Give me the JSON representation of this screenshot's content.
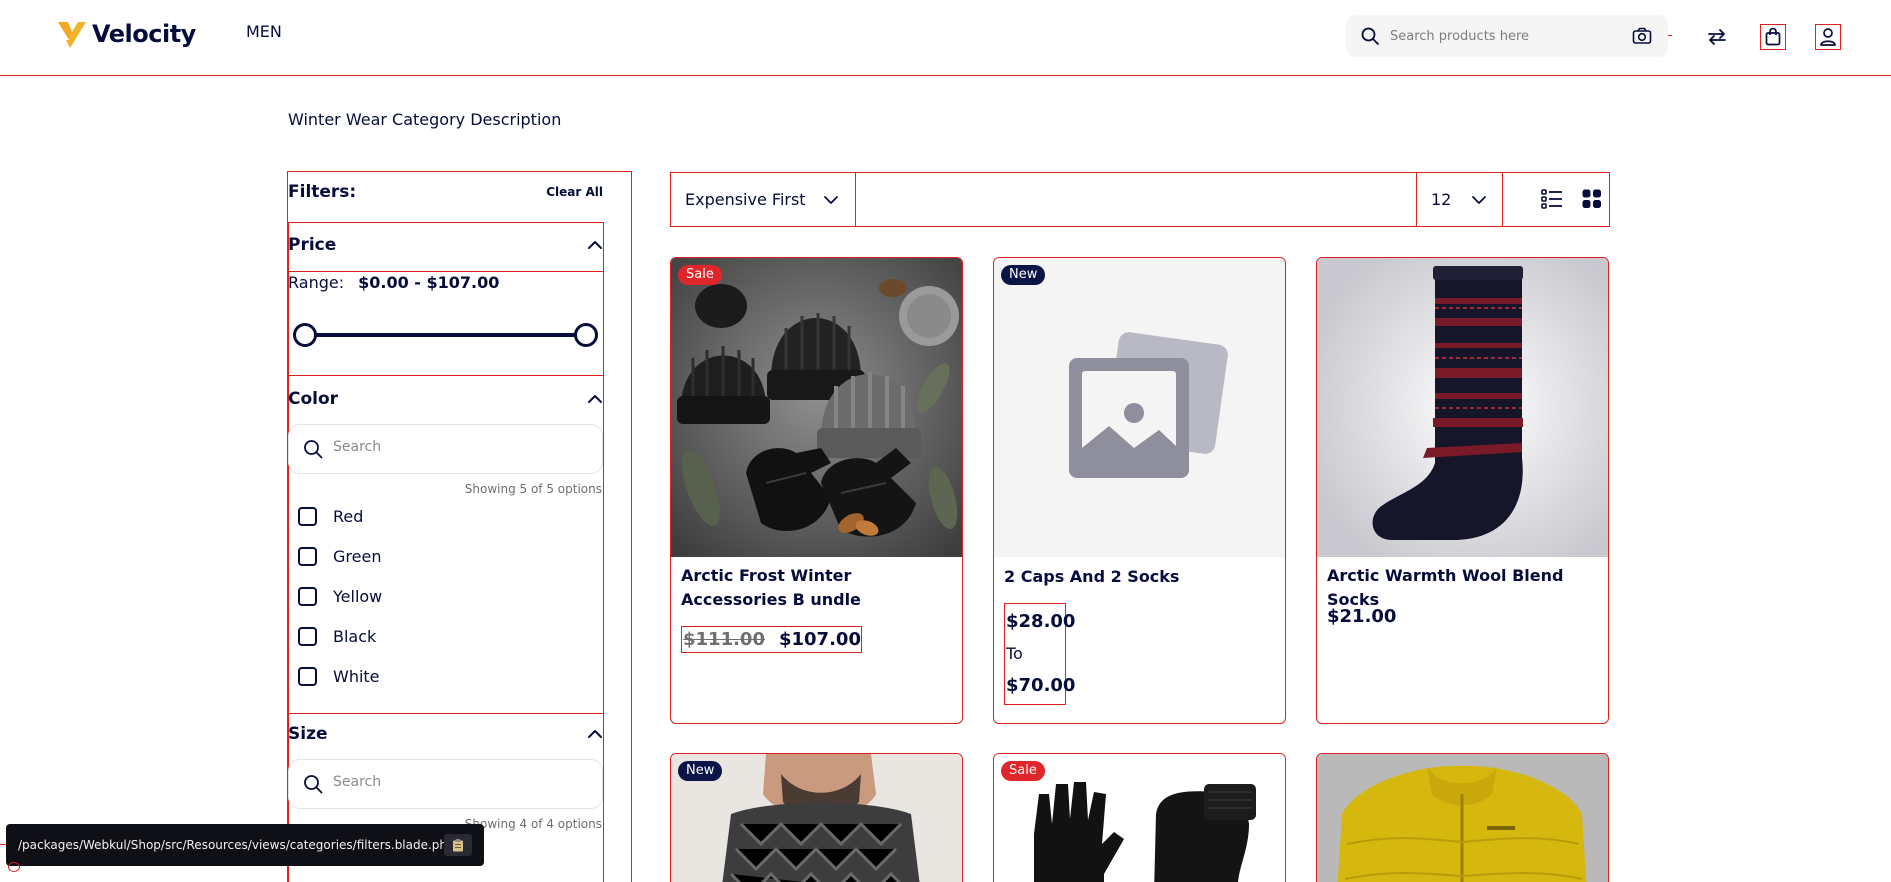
{
  "header": {
    "brand": "Velocity",
    "nav": [
      {
        "label": "MEN"
      }
    ],
    "search": {
      "placeholder": "Search products here"
    },
    "icons": [
      "search-icon",
      "camera-icon",
      "compare-icon",
      "cart-icon",
      "account-icon"
    ]
  },
  "category": {
    "description": "Winter Wear Category Description"
  },
  "filters": {
    "title": "Filters:",
    "clear_label": "Clear All",
    "price": {
      "title": "Price",
      "range_label": "Range:",
      "range_value": "$0.00 - $107.00",
      "slider_min_fraction": 0,
      "slider_max_fraction": 1
    },
    "color": {
      "title": "Color",
      "search_placeholder": "Search",
      "showing": "Showing 5 of 5 options",
      "options": [
        {
          "label": "Red",
          "checked": false
        },
        {
          "label": "Green",
          "checked": false
        },
        {
          "label": "Yellow",
          "checked": false
        },
        {
          "label": "Black",
          "checked": false
        },
        {
          "label": "White",
          "checked": false
        }
      ]
    },
    "size": {
      "title": "Size",
      "search_placeholder": "Search",
      "showing": "Showing 4 of 4 options"
    }
  },
  "toolbar": {
    "sort_value": "Expensive First",
    "limit_value": "12",
    "view_modes": [
      "list-view-icon",
      "grid-view-icon"
    ],
    "active_view": "grid"
  },
  "products": [
    {
      "badge": "Sale",
      "name": "Arctic Frost Winter Accessories B undle",
      "old_price": "$111.00",
      "price": "$107.00"
    },
    {
      "badge": "New",
      "name": "2 Caps And 2 Socks",
      "price_from": "$28.00",
      "to_label": "To",
      "price_to": "$70.00"
    },
    {
      "badge": "",
      "name": "Arctic Warmth Wool Blend Socks",
      "price": "$21.00"
    },
    {
      "badge": "New",
      "name": ""
    },
    {
      "badge": "Sale",
      "name": ""
    },
    {
      "badge": "",
      "name": ""
    }
  ],
  "dev": {
    "path": "/packages/Webkul/Shop/src/Resources/views/categories/filters.blade.php",
    "copy_icon": "clipboard-icon"
  },
  "colors": {
    "brand_navy": "#060c3b",
    "sale_red": "#e0262b",
    "new_navy": "#0b1547",
    "debug_outline": "#e02020",
    "logo_orange": "#f5a623",
    "logo_blue": "#2d7ff9"
  }
}
